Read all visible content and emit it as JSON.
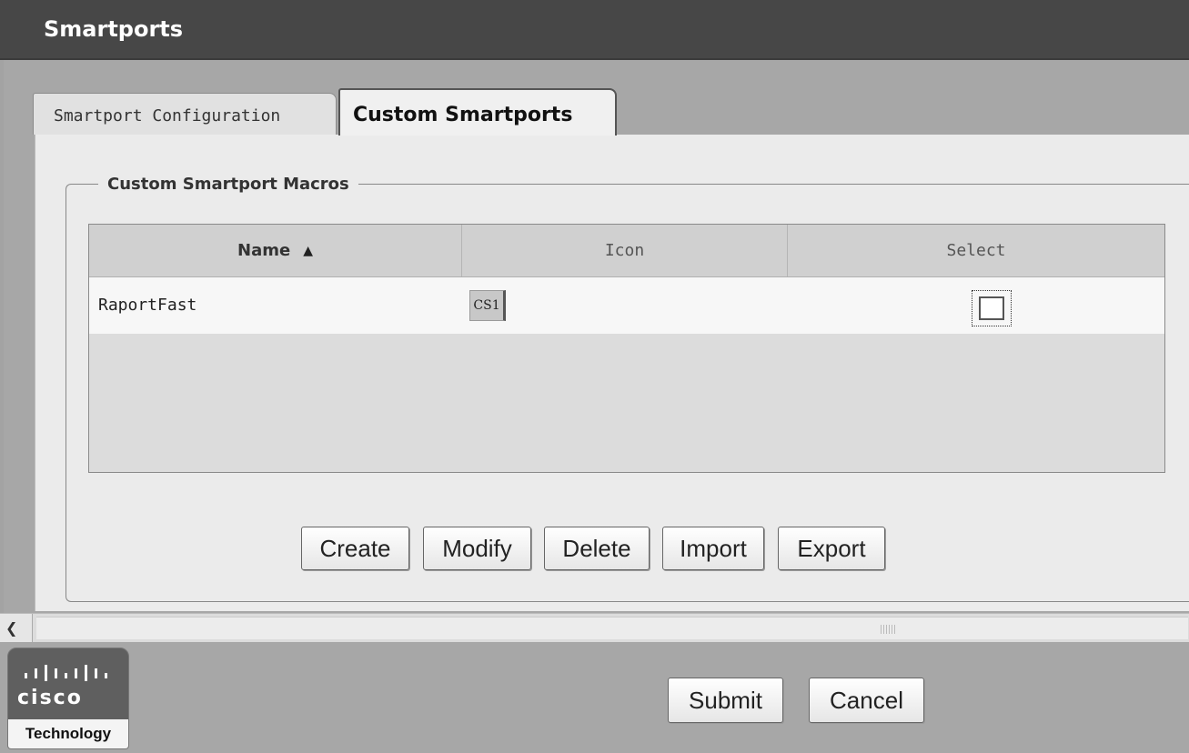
{
  "window": {
    "title": "Smartports"
  },
  "tabs": [
    {
      "label": "Smartport Configuration",
      "active": false
    },
    {
      "label": "Custom Smartports",
      "active": true
    }
  ],
  "macros_group": {
    "legend": "Custom Smartport Macros",
    "columns": [
      {
        "label": "Name",
        "sorted": "ascending"
      },
      {
        "label": "Icon"
      },
      {
        "label": "Select"
      }
    ],
    "rows": [
      {
        "name": "RaportFast",
        "icon_text": "CS1",
        "selected": false
      }
    ],
    "buttons": {
      "create": "Create",
      "modify": "Modify",
      "delete": "Delete",
      "import": "Import",
      "export": "Export"
    }
  },
  "footer": {
    "logo": {
      "wordmark": "CISCO",
      "tagline": "Technology"
    },
    "submit_label": "Submit",
    "cancel_label": "Cancel"
  },
  "icons": {
    "sort_arrow": "triangle-up",
    "scroll_left": "chevron-left"
  },
  "colors": {
    "titlebar": "#474747",
    "background": "#a7a7a7",
    "panel": "#ebebeb"
  }
}
